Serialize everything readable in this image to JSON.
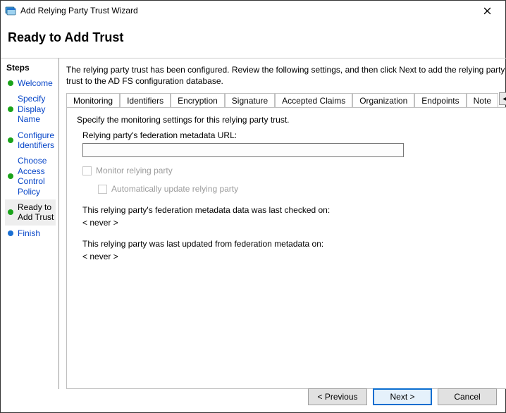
{
  "window": {
    "title": "Add Relying Party Trust Wizard",
    "heading": "Ready to Add Trust"
  },
  "steps": {
    "heading": "Steps",
    "items": [
      {
        "label": "Welcome",
        "bullet": "green",
        "active": false
      },
      {
        "label": "Specify Display Name",
        "bullet": "green",
        "active": false
      },
      {
        "label": "Configure Identifiers",
        "bullet": "green",
        "active": false
      },
      {
        "label": "Choose Access Control Policy",
        "bullet": "green",
        "active": false
      },
      {
        "label": "Ready to Add Trust",
        "bullet": "green",
        "active": true
      },
      {
        "label": "Finish",
        "bullet": "blue",
        "active": false
      }
    ]
  },
  "main": {
    "intro": "The relying party trust has been configured. Review the following settings, and then click Next to add the relying party trust to the AD FS configuration database.",
    "tabs": [
      {
        "label": "Monitoring",
        "active": true
      },
      {
        "label": "Identifiers",
        "active": false
      },
      {
        "label": "Encryption",
        "active": false
      },
      {
        "label": "Signature",
        "active": false
      },
      {
        "label": "Accepted Claims",
        "active": false
      },
      {
        "label": "Organization",
        "active": false
      },
      {
        "label": "Endpoints",
        "active": false
      },
      {
        "label": "Note",
        "active": false
      }
    ],
    "monitoring": {
      "subhead": "Specify the monitoring settings for this relying party trust.",
      "url_label": "Relying party's federation metadata URL:",
      "url_value": "",
      "monitor_label": "Monitor relying party",
      "auto_update_label": "Automatically update relying party",
      "last_checked_label": "This relying party's federation metadata data was last checked on:",
      "last_checked_value": "< never >",
      "last_updated_label": "This relying party was last updated from federation metadata on:",
      "last_updated_value": "< never >"
    }
  },
  "buttons": {
    "previous": "< Previous",
    "next": "Next >",
    "cancel": "Cancel"
  }
}
